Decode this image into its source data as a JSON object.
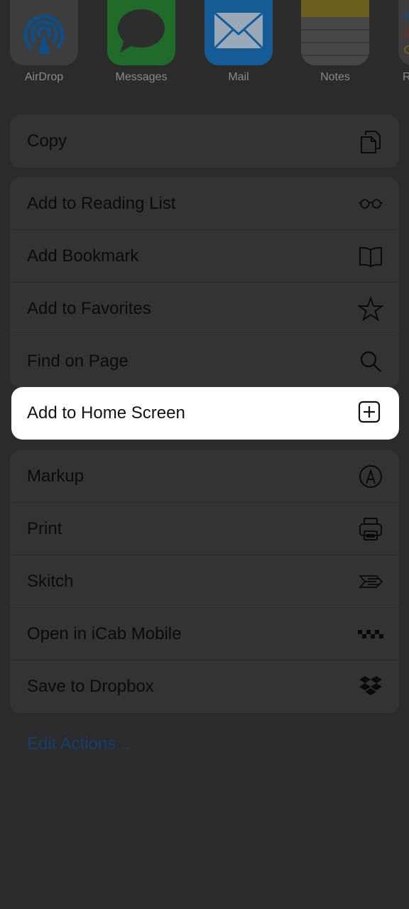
{
  "apps": [
    {
      "label": "AirDrop",
      "icon": "airdrop-icon"
    },
    {
      "label": "Messages",
      "icon": "messages-icon"
    },
    {
      "label": "Mail",
      "icon": "mail-icon"
    },
    {
      "label": "Notes",
      "icon": "notes-icon"
    },
    {
      "label": "R",
      "icon": "reminders-icon"
    }
  ],
  "group1": [
    {
      "label": "Copy",
      "icon": "copy-icon"
    }
  ],
  "group2": [
    {
      "label": "Add to Reading List",
      "icon": "glasses-icon"
    },
    {
      "label": "Add Bookmark",
      "icon": "book-icon"
    },
    {
      "label": "Add to Favorites",
      "icon": "star-icon"
    },
    {
      "label": "Find on Page",
      "icon": "search-icon"
    }
  ],
  "highlight": {
    "label": "Add to Home Screen",
    "icon": "plus-square-icon"
  },
  "group3": [
    {
      "label": "Markup",
      "icon": "markup-icon"
    },
    {
      "label": "Print",
      "icon": "printer-icon"
    },
    {
      "label": "Skitch",
      "icon": "skitch-icon"
    },
    {
      "label": "Open in iCab Mobile",
      "icon": "icab-icon"
    },
    {
      "label": "Save to Dropbox",
      "icon": "dropbox-icon"
    }
  ],
  "edit_actions": "Edit Actions...",
  "colors": {
    "overlay": "#2b2b2b",
    "row": "#333333",
    "highlight": "#ffffff",
    "link": "#163e6e"
  }
}
